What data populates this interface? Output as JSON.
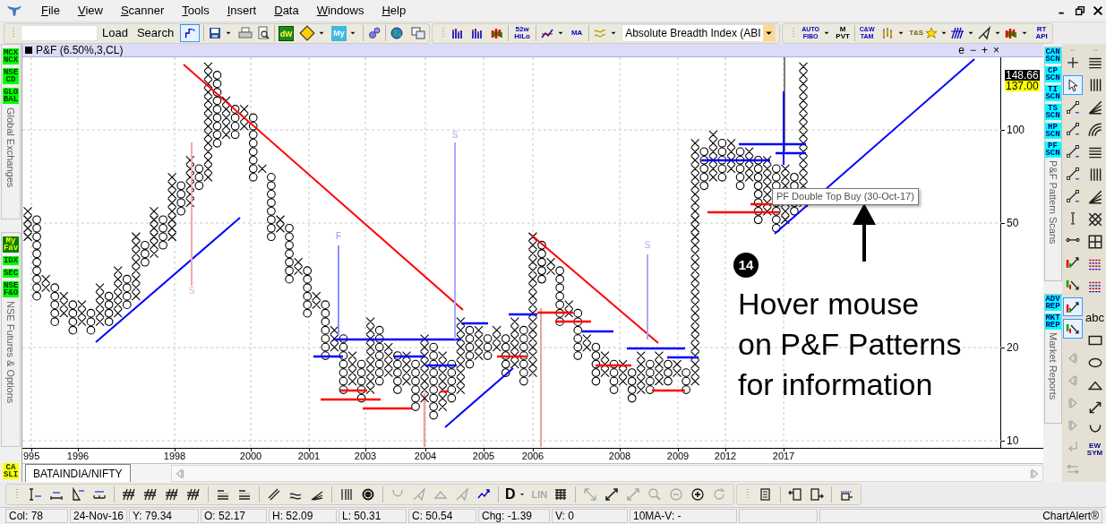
{
  "menu_bar": {
    "items": [
      "File",
      "View",
      "Scanner",
      "Tools",
      "Insert",
      "Data",
      "Windows",
      "Help"
    ]
  },
  "toolbar": {
    "buttons": [
      "Load",
      "Search"
    ],
    "chart_style_pressed": true,
    "icon_labels": [
      "dW",
      "My",
      "52w HiLo",
      "MA",
      "AUTO FIBO",
      "M PVT",
      "C&W TAM",
      "T&S",
      "RT API"
    ],
    "indicator_dropdown": {
      "value": "Absolute Breadth Index (ABI"
    }
  },
  "left_panel": {
    "groups": [
      {
        "buttons": [
          {
            "label": "MCX NCX",
            "color": "#00ff00"
          },
          {
            "label": "NSE CD",
            "color": "#00ff00"
          },
          {
            "label": "GLO BAL",
            "color": "#00ff00"
          }
        ],
        "title": "Global Exchanges"
      },
      {
        "buttons": [
          {
            "label": "My Fav",
            "color": "#008000"
          },
          {
            "label": "IDX",
            "color": "#00ff00"
          },
          {
            "label": "SEC",
            "color": "#00ff00"
          },
          {
            "label": "NSE F&O",
            "color": "#00ff00"
          }
        ],
        "title": "NSE Futures & Options"
      }
    ],
    "bottom_button": {
      "label": "CA SLI",
      "color": "#ffff00"
    }
  },
  "chart": {
    "header": {
      "title": "P&F (6.50%,3,CL)",
      "controls": [
        "e",
        "−",
        "+",
        "×"
      ]
    },
    "y_axis_labels": [
      "100",
      "50",
      "20",
      "10"
    ],
    "price_badges": [
      {
        "text": "148.66",
        "color": "#000000"
      },
      {
        "text": "137.00",
        "color": "#ffff00"
      }
    ],
    "x_axis_labels": [
      "995",
      "1996",
      "1998",
      "2000",
      "2001",
      "2003",
      "2004",
      "2005",
      "2006",
      "2008",
      "2009",
      "2012",
      "2017"
    ],
    "target_labels": [
      "S",
      "F",
      "S",
      "S"
    ],
    "tooltip": "PF Double Top Buy (30-Oct-17)",
    "annotation": {
      "number": "14",
      "lines": [
        "Hover mouse",
        "on P&F Patterns",
        "for information"
      ]
    },
    "tabs": [
      {
        "label": "BATAINDIA/NIFTY",
        "selected": true
      }
    ]
  },
  "right_panel": {
    "scan_buttons": [
      "CAN SCN",
      "CP SCN",
      "TI SCN",
      "TS SCN",
      "HP SCN",
      "PF SCN"
    ],
    "scan_title": "P&F Pattern Scans",
    "report_buttons": [
      "ADV REP",
      "MKT REP"
    ],
    "report_title": "Market Reports",
    "tools_column_1": [
      {
        "pressed": false,
        "disabled": false
      },
      {
        "pressed": true,
        "disabled": false
      },
      {
        "pressed": false,
        "disabled": false
      },
      {
        "pressed": false,
        "disabled": false
      },
      {
        "pressed": false,
        "disabled": false
      },
      {
        "pressed": false,
        "disabled": false
      },
      {
        "pressed": false,
        "disabled": false
      },
      {
        "pressed": false,
        "disabled": false
      },
      {
        "pressed": false,
        "disabled": false
      },
      {
        "pressed": false,
        "disabled": false
      },
      {
        "pressed": false,
        "disabled": false
      },
      {
        "pressed": true,
        "disabled": false
      },
      {
        "pressed": true,
        "disabled": false
      },
      {
        "pressed": false,
        "disabled": true
      },
      {
        "pressed": false,
        "disabled": true
      },
      {
        "pressed": false,
        "disabled": true
      },
      {
        "pressed": false,
        "disabled": true
      },
      {
        "pressed": false,
        "disabled": true
      },
      {
        "pressed": false,
        "disabled": true
      }
    ],
    "tool_labels": [
      "abc",
      "EW SYM"
    ]
  },
  "bottom_toolbar": {
    "labels": [
      {
        "text": "D",
        "disabled": false
      },
      {
        "text": "LIN",
        "disabled": true
      }
    ],
    "tools": [
      {
        "disabled": false
      },
      {
        "disabled": false
      },
      {
        "disabled": false
      },
      {
        "disabled": false
      },
      {
        "disabled": false
      },
      {
        "disabled": false
      },
      {
        "disabled": false
      },
      {
        "disabled": false
      },
      {
        "disabled": false
      },
      {
        "disabled": false
      },
      {
        "disabled": false
      },
      {
        "disabled": false
      },
      {
        "disabled": false
      },
      {
        "disabled": false
      },
      {
        "disabled": false
      },
      {
        "disabled": true
      },
      {
        "disabled": true
      },
      {
        "disabled": true
      },
      {
        "disabled": true
      },
      {
        "disabled": false
      },
      {
        "disabled": false
      },
      {
        "disabled": true
      },
      {
        "disabled": false
      },
      {
        "disabled": true
      },
      {
        "disabled": true
      },
      {
        "disabled": true
      },
      {
        "disabled": false
      },
      {
        "disabled": true
      },
      {
        "disabled": false
      },
      {
        "disabled": false
      },
      {
        "disabled": false
      },
      {
        "disabled": false
      }
    ]
  },
  "status_bar": {
    "cells": [
      "Col: 78",
      "24-Nov-16",
      "Y: 79.34",
      "O: 52.17",
      "H: 52.09",
      "L: 50.31",
      "C: 50.54",
      "Chg: -1.39",
      "V: 0",
      "10MA-V: -",
      "ChartAlert®"
    ]
  }
}
